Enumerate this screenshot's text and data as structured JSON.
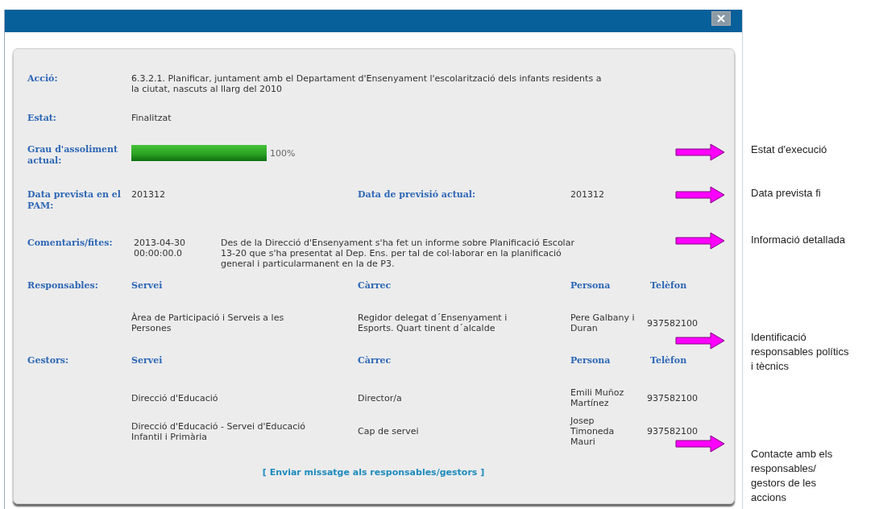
{
  "fields": [
    {
      "kind": "text",
      "label": "Acció:",
      "value": "6.3.2.1. Planificar, juntament amb el Departament d'Ensenyament l'escolarització dels infants residents a la ciutat, nascuts al llarg del 2010"
    },
    {
      "kind": "text",
      "label": "Estat:",
      "value": "Finalitzat"
    },
    {
      "kind": "progress",
      "label": "Grau d'assoliment actual:",
      "level": 1,
      "reading": "100%"
    },
    {
      "kind": "dates",
      "label": "Data prevista en el PAM:",
      "value": "201312",
      "label_2": "Data de previsió actual:",
      "value_2": "201312"
    },
    {
      "kind": "comment",
      "label": "Comentaris/fites:",
      "date": "2013-04-30 00:00:00.0",
      "value": "Des de la Direcció d'Ensenyament s'ha fet un informe sobre Planificació Escolar 13-20 que s'ha presentat al Dep. Ens. per tal de col·laborar en la planificació general i particularmanent en la de P3."
    }
  ],
  "groups": [
    {
      "label": "Responsables:",
      "columns": [
        "Servei",
        "Càrrec",
        "Persona",
        "Telèfon"
      ],
      "rows": [
        [
          "Àrea de Participació i Serveis a les Persones",
          "Regidor delegat d´Ensenyament i Esports. Quart tinent d´alcalde",
          "Pere Galbany i Duran",
          "937582100"
        ]
      ]
    },
    {
      "label": "Gestors:",
      "columns": [
        "Servei",
        "Càrrec",
        "Persona",
        "Telèfon"
      ],
      "rows": [
        [
          "Direcció d'Educació",
          "Director/a",
          "Emili Muñoz Martínez",
          "937582100"
        ],
        [
          "Direcció d'Educació - Servei d'Educació Infantil i Primària",
          "Cap de servei",
          "Josep Timoneda Mauri",
          "937582100"
        ]
      ]
    }
  ],
  "link": "[ Enviar missatge als responsables/gestors ]",
  "callouts": [
    "Estat d'execució",
    "Data prevista fi",
    "Informació detallada",
    "Identificació responsables polítics i tècnics",
    "Contacte amb els responsables/ gestors de les accions"
  ]
}
